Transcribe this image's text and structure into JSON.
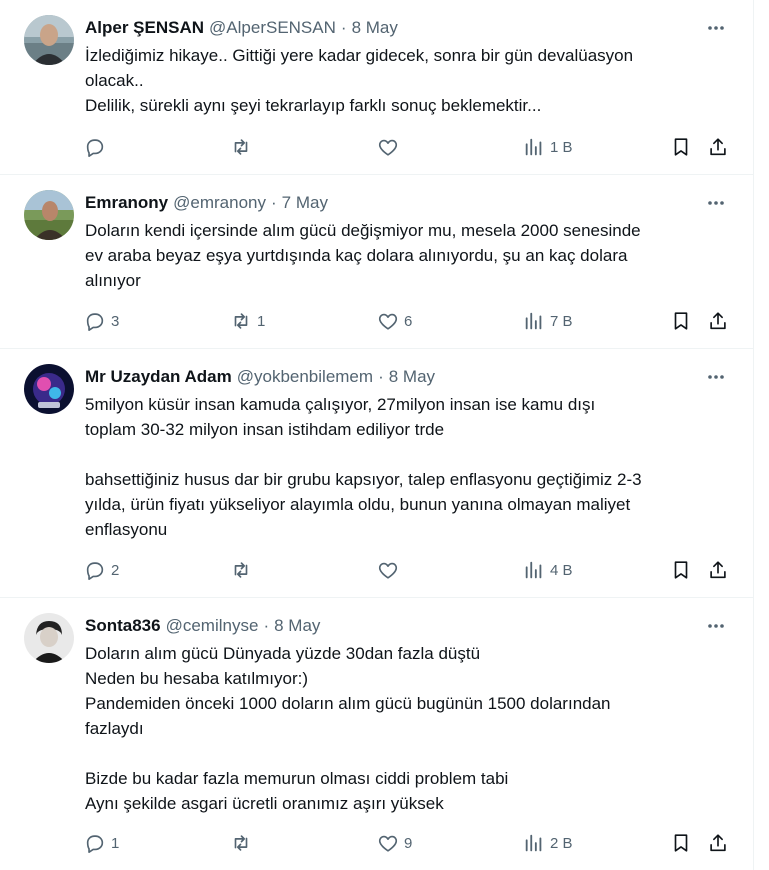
{
  "tweets": [
    {
      "name": "Alper ŞENSAN",
      "handle": "@AlperSENSAN",
      "date": "8 May",
      "lines": [
        "İzlediğimiz hikaye.. Gittiği yere kadar gidecek, sonra bir gün devalüasyon",
        "olacak..",
        "Delilik, sürekli aynı şeyi tekrarlayıp farklı sonuç beklemektir..."
      ],
      "replies": "",
      "retweets": "",
      "likes": "",
      "views": "1 B"
    },
    {
      "name": "Emranony",
      "handle": "@emranony",
      "date": "7 May",
      "lines": [
        "Doların kendi içersinde alım gücü değişmiyor mu, mesela 2000 senesinde",
        "ev araba beyaz eşya yurtdışında kaç dolara alınıyordu, şu an kaç dolara",
        "alınıyor"
      ],
      "replies": "3",
      "retweets": "1",
      "likes": "6",
      "views": "7 B"
    },
    {
      "name": "Mr Uzaydan Adam",
      "handle": "@yokbenbilemem",
      "date": "8 May",
      "lines": [
        "5milyon küsür insan kamuda çalışıyor, 27milyon insan ise kamu dışı",
        "toplam 30-32 milyon insan istihdam ediliyor trde",
        "",
        "bahsettiğiniz husus dar bir grubu kapsıyor, talep enflasyonu geçtiğimiz 2-3",
        "yılda, ürün fiyatı yükseliyor alayımla oldu, bunun yanına olmayan maliyet",
        "enflasyonu"
      ],
      "replies": "2",
      "retweets": "",
      "likes": "",
      "views": "4 B"
    },
    {
      "name": "Sonta836",
      "handle": "@cemilnyse",
      "date": "8 May",
      "lines": [
        "Doların alım gücü Dünyada yüzde 30dan fazla düştü",
        "Neden bu hesaba katılmıyor:)",
        "Pandemiden önceki 1000 doların alım gücü bugünün 1500 dolarından",
        "fazlaydı",
        "",
        "Bizde bu kadar fazla memurun olması ciddi problem tabi",
        "Aynı şekilde asgari ücretli oranımız aşırı yüksek"
      ],
      "replies": "1",
      "retweets": "",
      "likes": "9",
      "views": "2 B"
    }
  ],
  "colors": {
    "text": "#0f1419",
    "muted": "#536471",
    "border": "#eff3f4"
  },
  "icons": {
    "more": "more-horizontal-icon",
    "reply": "reply-icon",
    "retweet": "retweet-icon",
    "like": "like-icon",
    "views": "views-icon",
    "bookmark": "bookmark-icon",
    "share": "share-icon"
  }
}
